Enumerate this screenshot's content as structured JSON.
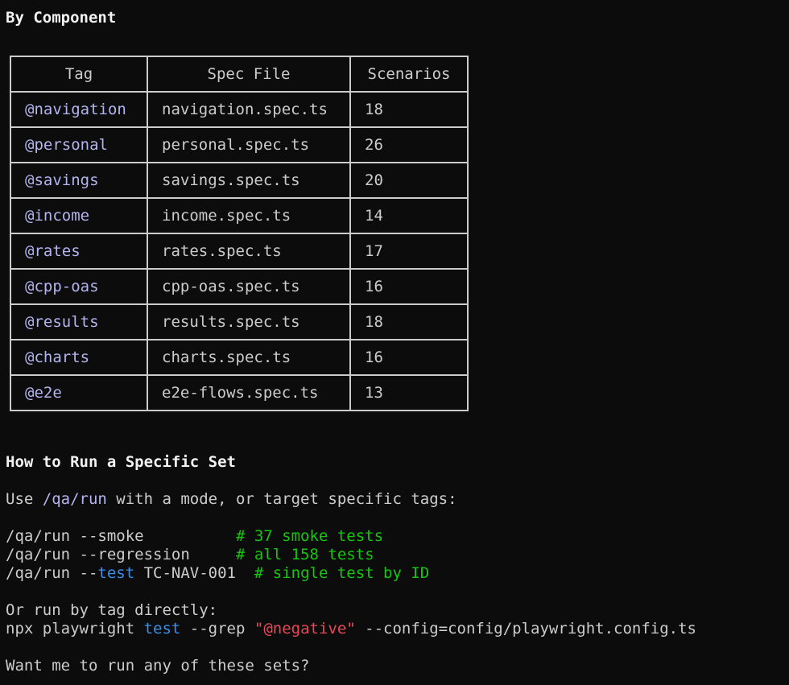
{
  "section1": {
    "title": "By Component"
  },
  "table": {
    "headers": [
      "Tag",
      "Spec File",
      "Scenarios"
    ],
    "rows": [
      {
        "tag": "@navigation",
        "spec": "navigation.spec.ts",
        "scenarios": "18"
      },
      {
        "tag": "@personal",
        "spec": "personal.spec.ts",
        "scenarios": "26"
      },
      {
        "tag": "@savings",
        "spec": "savings.spec.ts",
        "scenarios": "20"
      },
      {
        "tag": "@income",
        "spec": "income.spec.ts",
        "scenarios": "14"
      },
      {
        "tag": "@rates",
        "spec": "rates.spec.ts",
        "scenarios": "17"
      },
      {
        "tag": "@cpp-oas",
        "spec": "cpp-oas.spec.ts",
        "scenarios": "16"
      },
      {
        "tag": "@results",
        "spec": "results.spec.ts",
        "scenarios": "18"
      },
      {
        "tag": "@charts",
        "spec": "charts.spec.ts",
        "scenarios": "16"
      },
      {
        "tag": "@e2e",
        "spec": "e2e-flows.spec.ts",
        "scenarios": "13"
      }
    ]
  },
  "section2": {
    "title": "How to Run a Specific Set",
    "intro": {
      "pre": "Use ",
      "cmd": "/qa/run",
      "post": " with a mode, or target specific tags:"
    },
    "commands": [
      {
        "cmd": "/qa/run --smoke          ",
        "comment": "# 37 smoke tests"
      },
      {
        "cmd": "/qa/run --regression     ",
        "comment": "# all 158 tests"
      },
      {
        "cmd_pre": "/qa/run --",
        "keyword": "test",
        "cmd_post": " TC-NAV-001  ",
        "comment": "# single test by ID"
      }
    ],
    "tag_intro": "Or run by tag directly:",
    "npx": {
      "pre": "npx playwright ",
      "keyword": "test",
      "mid": " --grep ",
      "string": "\"@negative\"",
      "post": " --config=config/playwright.config.ts"
    },
    "prompt": "Want me to run any of these sets?"
  },
  "colors": {
    "background": "#0c0c0c",
    "text": "#cccccc",
    "tag": "#b4b4f0",
    "keyword": "#3b8eea",
    "comment": "#16c60c",
    "string": "#e74856"
  }
}
